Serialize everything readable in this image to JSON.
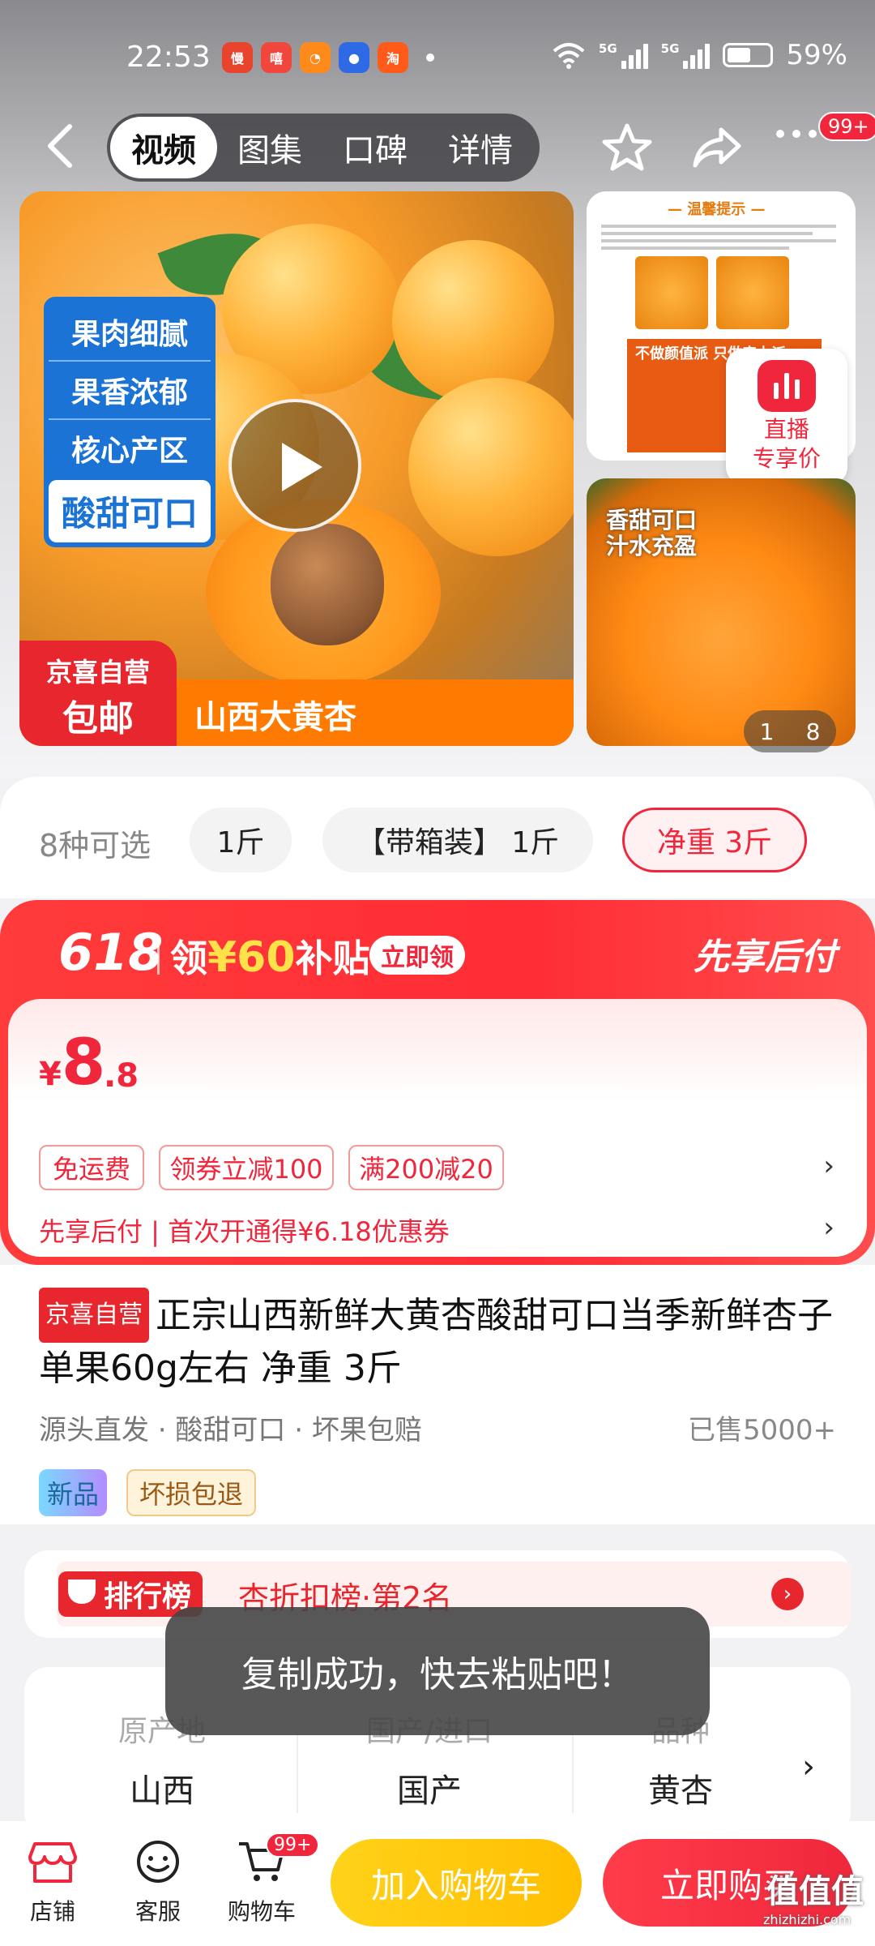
{
  "status_bar": {
    "time": "22:53",
    "apps": [
      "慢",
      "嘻",
      "淘"
    ],
    "signal_1": "5G",
    "signal_2": "5G",
    "battery": "59%"
  },
  "nav": {
    "tabs": [
      "视频",
      "图集",
      "口碑",
      "详情"
    ],
    "active_tab": "视频",
    "more_badge": "99+"
  },
  "gallery": {
    "features": [
      "果肉细腻",
      "果香浓郁",
      "核心产区"
    ],
    "feature_highlight": "酸甜可口",
    "jd_line1": "京喜自营",
    "jd_line2": "包邮",
    "product_caption": "山西大黄杏",
    "side_title": "— 温馨提示 —",
    "side_warning": "不做颜值派 只做实力派",
    "live_line1": "直播",
    "live_line2": "专享价",
    "side2_line1": "香甜可口",
    "side2_line2": "汁水充盈",
    "pager_current": "1",
    "pager_total": "8"
  },
  "sku": {
    "label": "8种可选",
    "options": [
      "1斤",
      "【带箱装】 1斤",
      "净重 3斤"
    ],
    "selected": "净重 3斤"
  },
  "promo": {
    "event": "618",
    "subsidy_prefix": "领",
    "subsidy_amount": "¥60",
    "subsidy_suffix": "补贴",
    "claim_label": "立即领",
    "pay_later_banner": "先享后付",
    "price_symbol": "¥",
    "price_int": "8",
    "price_dec": ".8",
    "coupons": [
      "免运费",
      "领券立减100",
      "满200减20"
    ],
    "pay_later_text": "先享后付 | 首次开通得¥6.18优惠券"
  },
  "product": {
    "badge": "京喜自营",
    "title": "正宗山西新鲜大黄杏酸甜可口当季新鲜杏子单果60g左右 净重 3斤",
    "tags": "源头直发 · 酸甜可口 · 坏果包赔",
    "sold": "已售5000+",
    "label_new": "新品",
    "label_refund": "坏损包退"
  },
  "ranking": {
    "badge": "排行榜",
    "text": "杏折扣榜·第2名"
  },
  "attributes": [
    {
      "key": "原产地",
      "value": "山西"
    },
    {
      "key": "国产/进口",
      "value": "国产"
    },
    {
      "key": "品种",
      "value": "黄杏"
    }
  ],
  "toast": "复制成功，快去粘贴吧！",
  "bottom_bar": {
    "shop": "店铺",
    "service": "客服",
    "cart": "购物车",
    "cart_badge": "99+",
    "add_to_cart": "加入购物车",
    "buy_now": "立即购买"
  },
  "watermark": {
    "logo": "值值值",
    "site": "zhizhizhi.com"
  },
  "colors": {
    "accent_red": "#f0273c",
    "orange": "#ff7a00",
    "yellow_btn": "#ffc400"
  }
}
